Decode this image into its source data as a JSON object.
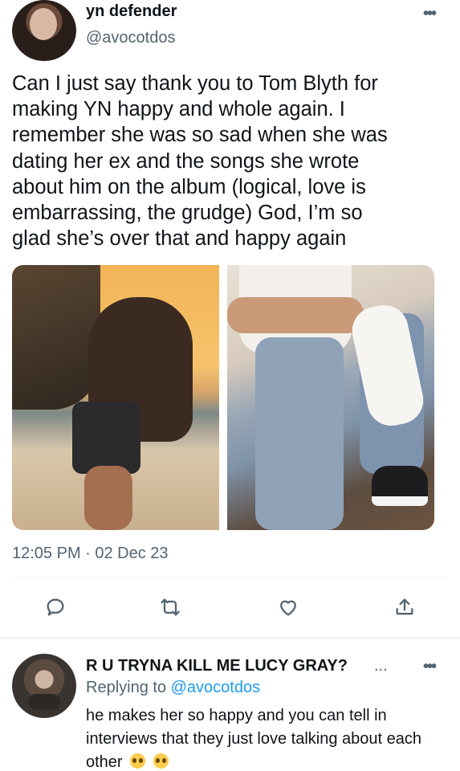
{
  "tweet": {
    "display_name": "yn defender",
    "handle": "@avocotdos",
    "text": "Can I just say thank you to Tom Blyth for\nmaking YN happy and whole again. I\nremember she was so sad when she was\ndating her ex and the songs she wrote\nabout him on the album (logical, love is\nembarrassing, the grudge) God, I’m so\nglad she’s over that and happy again",
    "timestamp": "12:05 PM · 02 Dec 23",
    "more_icon": "more-horizontal-icon",
    "media": [
      {
        "description_icon": "photo-beach-couple"
      },
      {
        "description_icon": "photo-jeans-sneakers"
      }
    ],
    "actions": [
      {
        "name": "reply",
        "icon": "comment-icon"
      },
      {
        "name": "retweet",
        "icon": "retweet-icon"
      },
      {
        "name": "like",
        "icon": "heart-icon"
      },
      {
        "name": "share",
        "icon": "share-icon"
      }
    ]
  },
  "reply": {
    "display_name": "R U TRYNA KILL ME LUCY GRAY?",
    "name_overflow": "...",
    "replying_prefix": "Replying to",
    "replying_handle": "@avocotdos",
    "text": "he makes her so happy and you can tell in interviews that they just love talking about each other",
    "emojis": [
      "pleading-face",
      "pleading-face"
    ]
  },
  "colors": {
    "text": "#0f1419",
    "secondary": "#536471",
    "link": "#1d9bf0",
    "divider": "#eff3f4"
  }
}
